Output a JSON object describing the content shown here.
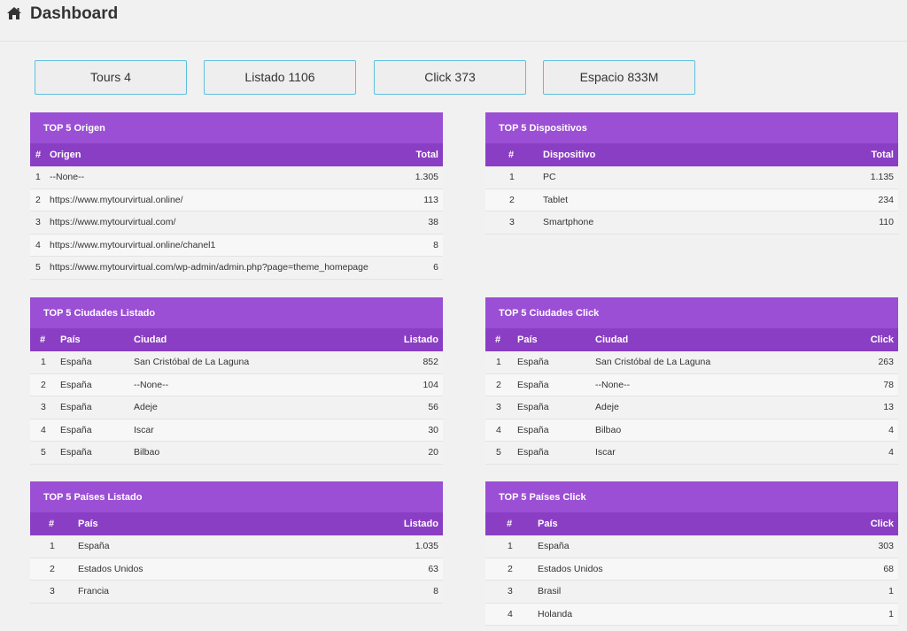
{
  "header": {
    "title": "Dashboard"
  },
  "stats": [
    "Tours 4",
    "Listado 1106",
    "Click 373",
    "Espacio 833M"
  ],
  "origen": {
    "title": "TOP 5 Origen",
    "cols": [
      "#",
      "Origen",
      "Total"
    ],
    "rows": [
      [
        "1",
        "--None--",
        "1.305"
      ],
      [
        "2",
        "https://www.mytourvirtual.online/",
        "113"
      ],
      [
        "3",
        "https://www.mytourvirtual.com/",
        "38"
      ],
      [
        "4",
        "https://www.mytourvirtual.online/chanel1",
        "8"
      ],
      [
        "5",
        "https://www.mytourvirtual.com/wp-admin/admin.php?page=theme_homepage",
        "6"
      ]
    ]
  },
  "dispositivos": {
    "title": "TOP 5 Dispositivos",
    "cols": [
      "#",
      "Dispositivo",
      "Total"
    ],
    "rows": [
      [
        "1",
        "PC",
        "1.135"
      ],
      [
        "2",
        "Tablet",
        "234"
      ],
      [
        "3",
        "Smartphone",
        "110"
      ]
    ]
  },
  "ciudades_listado": {
    "title": "TOP 5 Ciudades Listado",
    "cols": [
      "#",
      "País",
      "Ciudad",
      "Listado"
    ],
    "rows": [
      [
        "1",
        "España",
        "San Cristóbal de La Laguna",
        "852"
      ],
      [
        "2",
        "España",
        "--None--",
        "104"
      ],
      [
        "3",
        "España",
        "Adeje",
        "56"
      ],
      [
        "4",
        "España",
        "Iscar",
        "30"
      ],
      [
        "5",
        "España",
        "Bilbao",
        "20"
      ]
    ]
  },
  "ciudades_click": {
    "title": "TOP 5 Ciudades Click",
    "cols": [
      "#",
      "País",
      "Ciudad",
      "Click"
    ],
    "rows": [
      [
        "1",
        "España",
        "San Cristóbal de La Laguna",
        "263"
      ],
      [
        "2",
        "España",
        "--None--",
        "78"
      ],
      [
        "3",
        "España",
        "Adeje",
        "13"
      ],
      [
        "4",
        "España",
        "Bilbao",
        "4"
      ],
      [
        "5",
        "España",
        "Iscar",
        "4"
      ]
    ]
  },
  "paises_listado": {
    "title": "TOP 5 Países Listado",
    "cols": [
      "#",
      "País",
      "Listado"
    ],
    "rows": [
      [
        "1",
        "España",
        "1.035"
      ],
      [
        "2",
        "Estados Unidos",
        "63"
      ],
      [
        "3",
        "Francia",
        "8"
      ]
    ]
  },
  "paises_click": {
    "title": "TOP 5 Países Click",
    "cols": [
      "#",
      "País",
      "Click"
    ],
    "rows": [
      [
        "1",
        "España",
        "303"
      ],
      [
        "2",
        "Estados Unidos",
        "68"
      ],
      [
        "3",
        "Brasil",
        "1"
      ],
      [
        "4",
        "Holanda",
        "1"
      ]
    ]
  }
}
